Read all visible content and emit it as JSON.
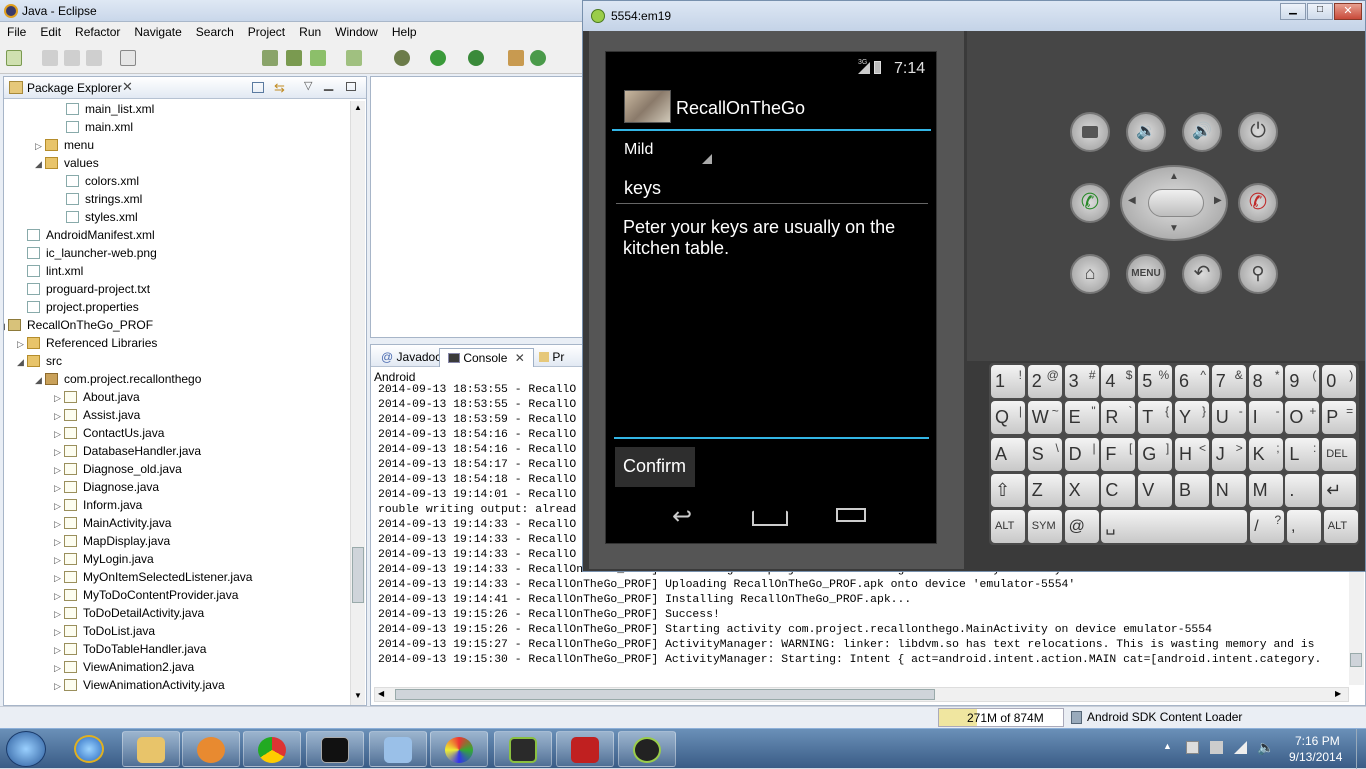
{
  "eclipse": {
    "title": "Java - Eclipse",
    "menu": [
      "File",
      "Edit",
      "Refactor",
      "Navigate",
      "Search",
      "Project",
      "Run",
      "Window",
      "Help"
    ],
    "package_explorer": {
      "title": "Package Explorer",
      "items": [
        {
          "label": "main_list.xml",
          "kind": "file"
        },
        {
          "label": "main.xml",
          "kind": "file"
        },
        {
          "label": "menu",
          "kind": "folder"
        },
        {
          "label": "values",
          "kind": "folder"
        },
        {
          "label": "colors.xml",
          "kind": "file"
        },
        {
          "label": "strings.xml",
          "kind": "file"
        },
        {
          "label": "styles.xml",
          "kind": "file"
        },
        {
          "label": "AndroidManifest.xml",
          "kind": "file"
        },
        {
          "label": "ic_launcher-web.png",
          "kind": "image"
        },
        {
          "label": "lint.xml",
          "kind": "file"
        },
        {
          "label": "proguard-project.txt",
          "kind": "file"
        },
        {
          "label": "project.properties",
          "kind": "file"
        },
        {
          "label": "RecallOnTheGo_PROF",
          "kind": "project"
        },
        {
          "label": "Referenced Libraries",
          "kind": "library"
        },
        {
          "label": "src",
          "kind": "folder"
        },
        {
          "label": "com.project.recallonthego",
          "kind": "package"
        },
        {
          "label": "About.java",
          "kind": "java"
        },
        {
          "label": "Assist.java",
          "kind": "java"
        },
        {
          "label": "ContactUs.java",
          "kind": "java"
        },
        {
          "label": "DatabaseHandler.java",
          "kind": "java"
        },
        {
          "label": "Diagnose_old.java",
          "kind": "java"
        },
        {
          "label": "Diagnose.java",
          "kind": "java"
        },
        {
          "label": "Inform.java",
          "kind": "java"
        },
        {
          "label": "MainActivity.java",
          "kind": "java"
        },
        {
          "label": "MapDisplay.java",
          "kind": "java"
        },
        {
          "label": "MyLogin.java",
          "kind": "java"
        },
        {
          "label": "MyOnItemSelectedListener.java",
          "kind": "java"
        },
        {
          "label": "MyToDoContentProvider.java",
          "kind": "java"
        },
        {
          "label": "ToDoDetailActivity.java",
          "kind": "java"
        },
        {
          "label": "ToDoList.java",
          "kind": "java"
        },
        {
          "label": "ToDoTableHandler.java",
          "kind": "java"
        },
        {
          "label": "ViewAnimation2.java",
          "kind": "java"
        },
        {
          "label": "ViewAnimationActivity.java",
          "kind": "java"
        }
      ]
    },
    "console": {
      "tabs": [
        "Javadoc",
        "Console",
        "Pr"
      ],
      "label": "Android",
      "lines": [
        "2014-09-13 18:53:55 - RecallO",
        "2014-09-13 18:53:55 - RecallO",
        "2014-09-13 18:53:59 - RecallO",
        "2014-09-13 18:54:16 - RecallO",
        "2014-09-13 18:54:16 - RecallO",
        "2014-09-13 18:54:17 - RecallO",
        "2014-09-13 18:54:18 - RecallO",
        "2014-09-13 19:14:01 - RecallO",
        "rouble writing output: alread",
        "2014-09-13 19:14:33 - RecallO",
        "2014-09-13 19:14:33 - RecallO",
        "2014-09-13 19:14:33 - RecallO",
        "2014-09-13 19:14:33 - RecallOnTheGo_PROF] Performing com.project.recallonthego.MainActivity activity launch",
        "2014-09-13 19:14:33 - RecallOnTheGo_PROF] Uploading RecallOnTheGo_PROF.apk onto device 'emulator-5554'",
        "2014-09-13 19:14:41 - RecallOnTheGo_PROF] Installing RecallOnTheGo_PROF.apk...",
        "2014-09-13 19:15:26 - RecallOnTheGo_PROF] Success!",
        "2014-09-13 19:15:26 - RecallOnTheGo_PROF] Starting activity com.project.recallonthego.MainActivity on device emulator-5554",
        "2014-09-13 19:15:27 - RecallOnTheGo_PROF] ActivityManager: WARNING: linker: libdvm.so has text relocations. This is wasting memory and is",
        "2014-09-13 19:15:30 - RecallOnTheGo_PROF] ActivityManager: Starting: Intent { act=android.intent.action.MAIN cat=[android.intent.category."
      ]
    },
    "status": {
      "memory": "271M of 874M",
      "task": "Android SDK Content Loader"
    }
  },
  "emulator": {
    "title": "5554:em19",
    "phone": {
      "time": "7:14",
      "network": "3G",
      "app_title": "RecallOnTheGo",
      "spinner_value": "Mild",
      "keyword_value": "keys",
      "message_value": "Peter your keys are usually on the kitchen table.",
      "confirm_label": "Confirm"
    },
    "keyboard": {
      "row1": [
        [
          "1",
          "!"
        ],
        [
          "2",
          "@"
        ],
        [
          "3",
          "#"
        ],
        [
          "4",
          "$"
        ],
        [
          "5",
          "%"
        ],
        [
          "6",
          "^"
        ],
        [
          "7",
          "&"
        ],
        [
          "8",
          "*"
        ],
        [
          "9",
          "("
        ],
        [
          "0",
          ")"
        ]
      ],
      "row2": [
        [
          "Q",
          "|"
        ],
        [
          "W",
          "~"
        ],
        [
          "E",
          "\""
        ],
        [
          "R",
          "`"
        ],
        [
          "T",
          "{"
        ],
        [
          "Y",
          "}"
        ],
        [
          "U",
          "-"
        ],
        [
          "I",
          "-"
        ],
        [
          "O",
          "+"
        ],
        [
          "P",
          "="
        ]
      ],
      "row3": [
        [
          "A",
          ""
        ],
        [
          "S",
          "\\"
        ],
        [
          "D",
          "|"
        ],
        [
          "F",
          "["
        ],
        [
          "G",
          "]"
        ],
        [
          "H",
          "<"
        ],
        [
          "J",
          ">"
        ],
        [
          "K",
          ";"
        ],
        [
          "L",
          ":"
        ],
        [
          "DEL",
          ""
        ]
      ],
      "row4": [
        [
          "⇧",
          ""
        ],
        [
          "Z",
          ""
        ],
        [
          "X",
          ""
        ],
        [
          "C",
          ""
        ],
        [
          "V",
          ""
        ],
        [
          "B",
          ""
        ],
        [
          "N",
          ""
        ],
        [
          "M",
          ""
        ],
        [
          ".",
          ""
        ],
        [
          "↵",
          ""
        ]
      ],
      "row5": [
        [
          "ALT",
          ""
        ],
        [
          "SYM",
          ""
        ],
        [
          "@",
          ""
        ],
        [
          "␣",
          ""
        ],
        [
          "/",
          "?"
        ],
        [
          ",",
          ""
        ],
        [
          "ALT",
          ""
        ]
      ],
      "menu_label": "MENU"
    }
  },
  "taskbar": {
    "time": "7:16 PM",
    "date": "9/13/2014"
  }
}
